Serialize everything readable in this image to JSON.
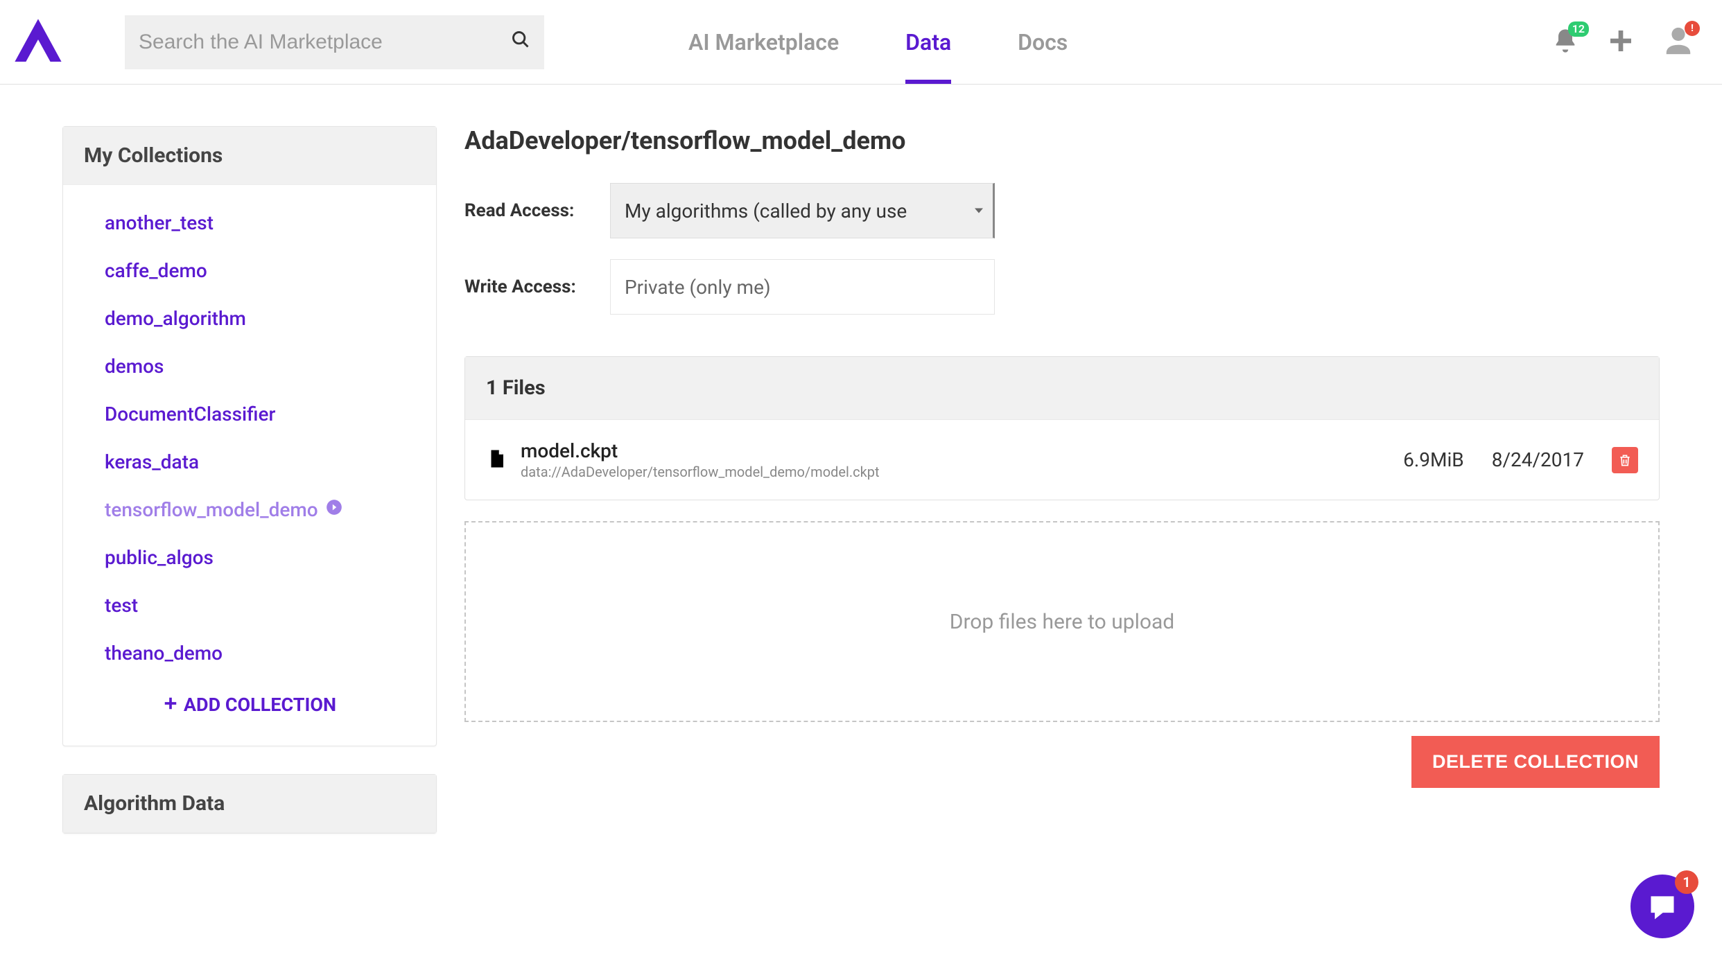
{
  "header": {
    "search_placeholder": "Search the AI Marketplace",
    "nav": [
      {
        "label": "AI Marketplace",
        "active": false
      },
      {
        "label": "Data",
        "active": true
      },
      {
        "label": "Docs",
        "active": false
      }
    ],
    "notification_count": "12",
    "avatar_alert": "!"
  },
  "sidebar": {
    "collections_title": "My Collections",
    "collections": [
      {
        "name": "another_test",
        "active": false
      },
      {
        "name": "caffe_demo",
        "active": false
      },
      {
        "name": "demo_algorithm",
        "active": false
      },
      {
        "name": "demos",
        "active": false
      },
      {
        "name": "DocumentClassifier",
        "active": false
      },
      {
        "name": "keras_data",
        "active": false
      },
      {
        "name": "tensorflow_model_demo",
        "active": true
      },
      {
        "name": "public_algos",
        "active": false
      },
      {
        "name": "test",
        "active": false
      },
      {
        "name": "theano_demo",
        "active": false
      }
    ],
    "add_collection_label": "ADD COLLECTION",
    "algorithm_data_title": "Algorithm Data"
  },
  "main": {
    "title": "AdaDeveloper/tensorflow_model_demo",
    "read_access_label": "Read Access:",
    "read_access_value": "My algorithms (called by any use",
    "write_access_label": "Write Access:",
    "write_access_value": "Private (only me)",
    "files_header": "1 Files",
    "files": [
      {
        "name": "model.ckpt",
        "path": "data://AdaDeveloper/tensorflow_model_demo/model.ckpt",
        "size": "6.9MiB",
        "date": "8/24/2017"
      }
    ],
    "dropzone_text": "Drop files here to upload",
    "delete_collection_label": "DELETE COLLECTION"
  },
  "chat": {
    "badge": "1"
  }
}
